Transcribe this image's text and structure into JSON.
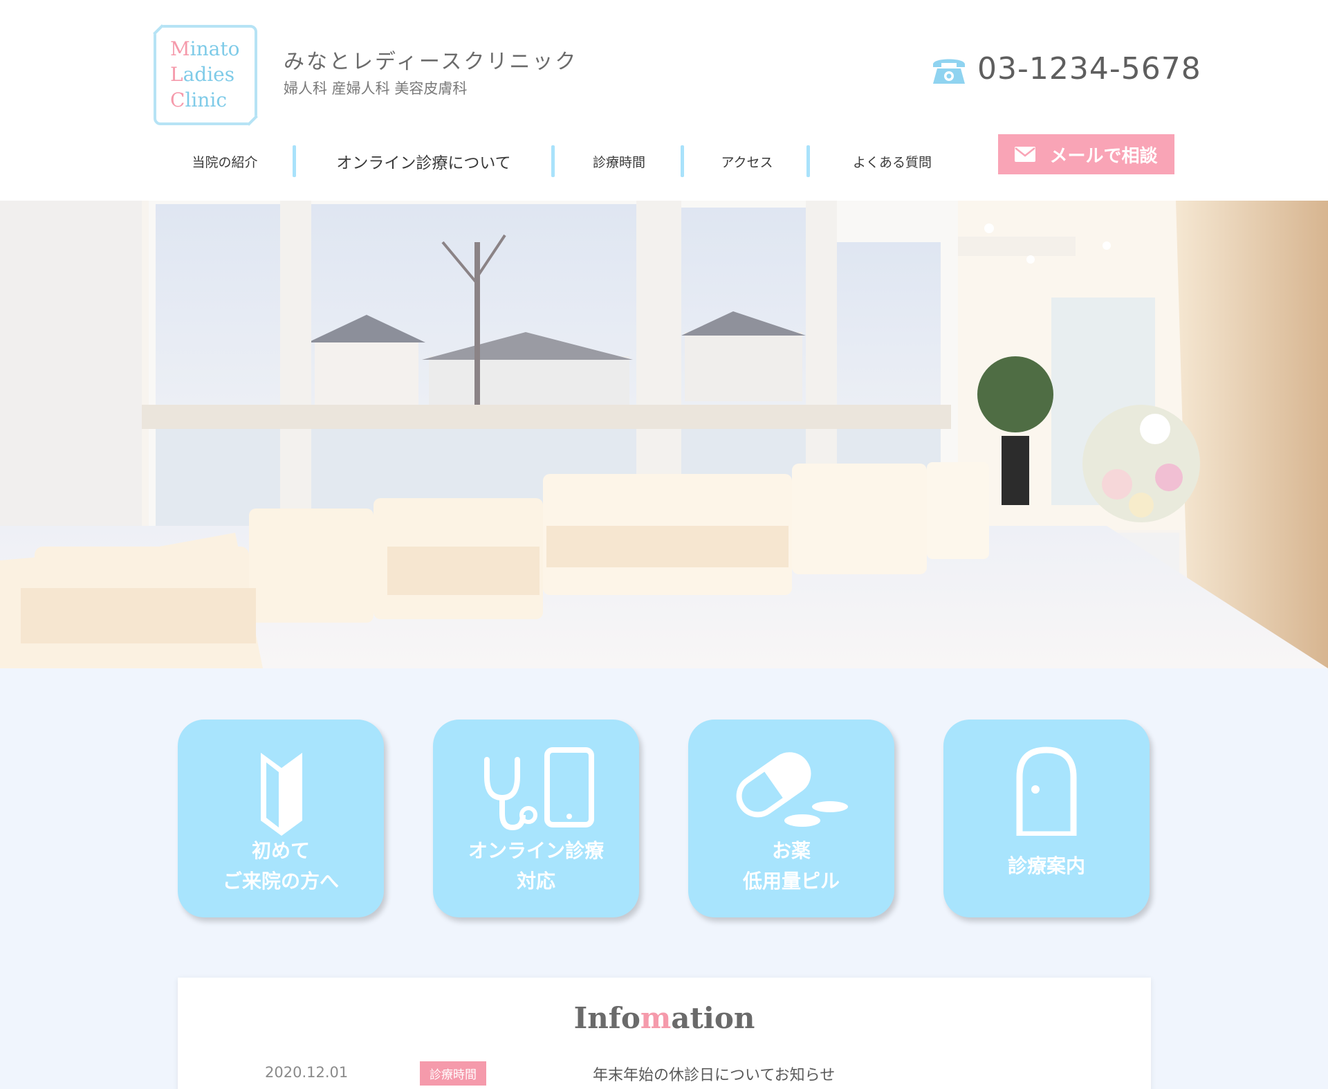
{
  "header": {
    "logo": [
      "Minato",
      "Ladies",
      "Clinic"
    ],
    "clinic_name": "みなとレディースクリニック",
    "clinic_sub": "婦人科 産婦人科 美容皮膚科",
    "phone": "03-1234-5678",
    "phone_icon": "telephone-icon",
    "mail_button": "メールで相談",
    "mail_icon": "envelope-icon"
  },
  "nav": {
    "items": [
      {
        "label": "当院の紹介"
      },
      {
        "label": "オンライン診療について"
      },
      {
        "label": "診療時間"
      },
      {
        "label": "アクセス"
      },
      {
        "label": "よくある質問"
      }
    ]
  },
  "hero": {
    "image": "clinic-waiting-room-photo"
  },
  "services": [
    {
      "line1": "初めて",
      "line2": "ご来院の方へ",
      "icon": "beginner-mark-icon"
    },
    {
      "line1": "オンライン診療",
      "line2": "対応",
      "icon": "stethoscope-smartphone-icon"
    },
    {
      "line1": "お薬",
      "line2": "低用量ピル",
      "icon": "pill-icon"
    },
    {
      "line1": "診療案内",
      "line2": "",
      "icon": "door-icon"
    }
  ],
  "info": {
    "title_pre": "Info",
    "title_accent": "m",
    "title_post": "ation",
    "news": [
      {
        "date": "2020.12.01",
        "tag": "診療時間",
        "title": "年末年始の休診日についてお知らせ"
      }
    ]
  },
  "colors": {
    "accent_pink": "#f59aab",
    "accent_blue": "#a8e4fd",
    "page_bg": "#f0f5fd"
  }
}
